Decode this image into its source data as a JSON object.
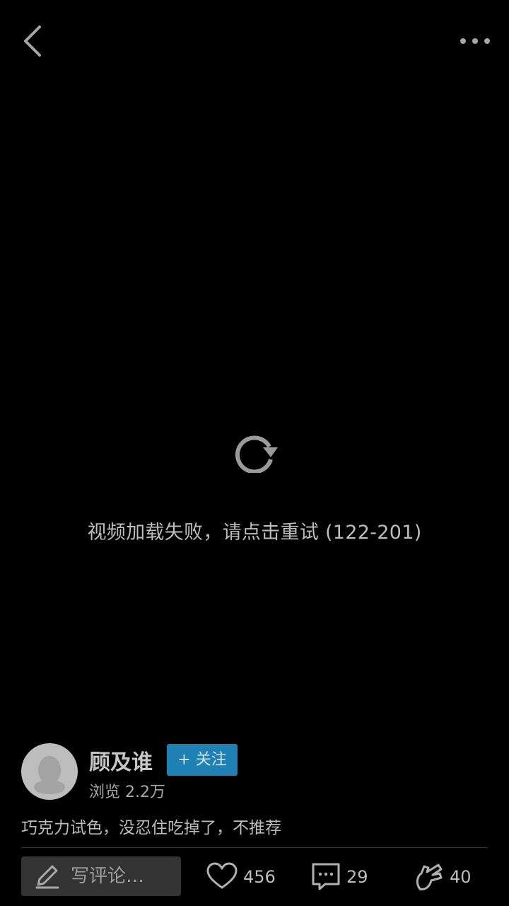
{
  "topbar": {
    "back_icon": "chevron-left-icon",
    "more_icon": "more-horizontal-icon"
  },
  "player": {
    "retry_icon": "refresh-icon",
    "error_text": "视频加载失败，请点击重试 (122-201)"
  },
  "author": {
    "name": "顾及谁",
    "follow_label": "+ 关注",
    "views": "浏览 2.2万"
  },
  "post": {
    "caption": "巧克力试色，没忍住吃掉了，不推荐"
  },
  "bottombar": {
    "comment_placeholder": "写评论…",
    "likes": "456",
    "comments": "29",
    "shares": "40"
  },
  "colors": {
    "background": "#000000",
    "follow_button": "#1f80b4",
    "comment_box": "#333333"
  }
}
